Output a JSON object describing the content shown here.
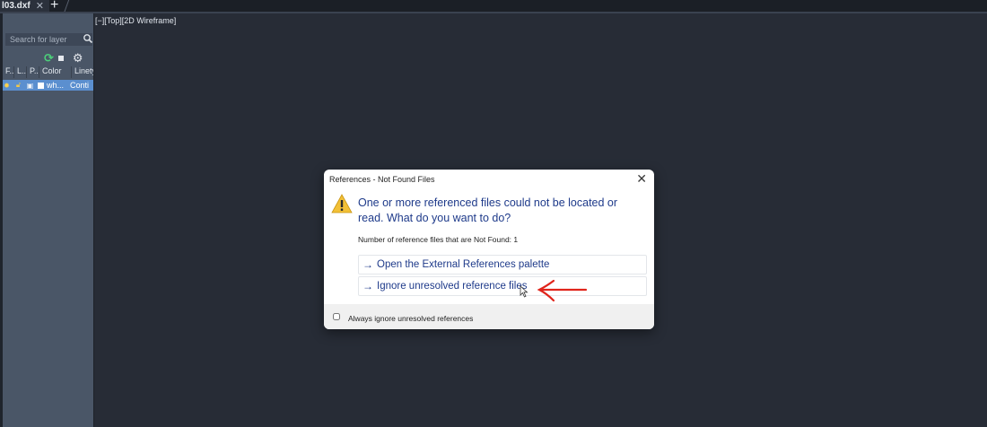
{
  "tabbar": {
    "file_tab_label": "l03.dxf",
    "close_glyph": "✕",
    "add_glyph": "+"
  },
  "layer_panel": {
    "search_placeholder": "Search for layer",
    "columns": [
      "F..",
      "L..",
      "P..",
      "Color",
      "Linety"
    ],
    "row": {
      "color_name": "wh...",
      "linetype": "Conti"
    },
    "icons": [
      "search-icon",
      "refresh-icon",
      "square-icon",
      "gear-icon",
      "sun-icon",
      "lock-icon",
      "printer-icon"
    ]
  },
  "viewport": {
    "label": "[−][Top][2D Wireframe]"
  },
  "dialog": {
    "title": "References - Not Found Files",
    "heading": "One or more referenced files could not be located or read. What do you want to do?",
    "count_text": "Number of reference files that are Not Found: 1",
    "options": [
      {
        "label": "Open the External References palette"
      },
      {
        "label": "Ignore unresolved reference files"
      }
    ],
    "footer_checkbox_label": "Always ignore unresolved references",
    "footer_checked": false,
    "icons": [
      "warning-icon",
      "close-icon",
      "arrow-right-icon"
    ]
  },
  "colors": {
    "background": "#272c36",
    "panel": "#4a5667",
    "link_blue": "#1e3a8a",
    "annotation_red": "#e0241b",
    "selected_row": "#5b8fcf"
  }
}
